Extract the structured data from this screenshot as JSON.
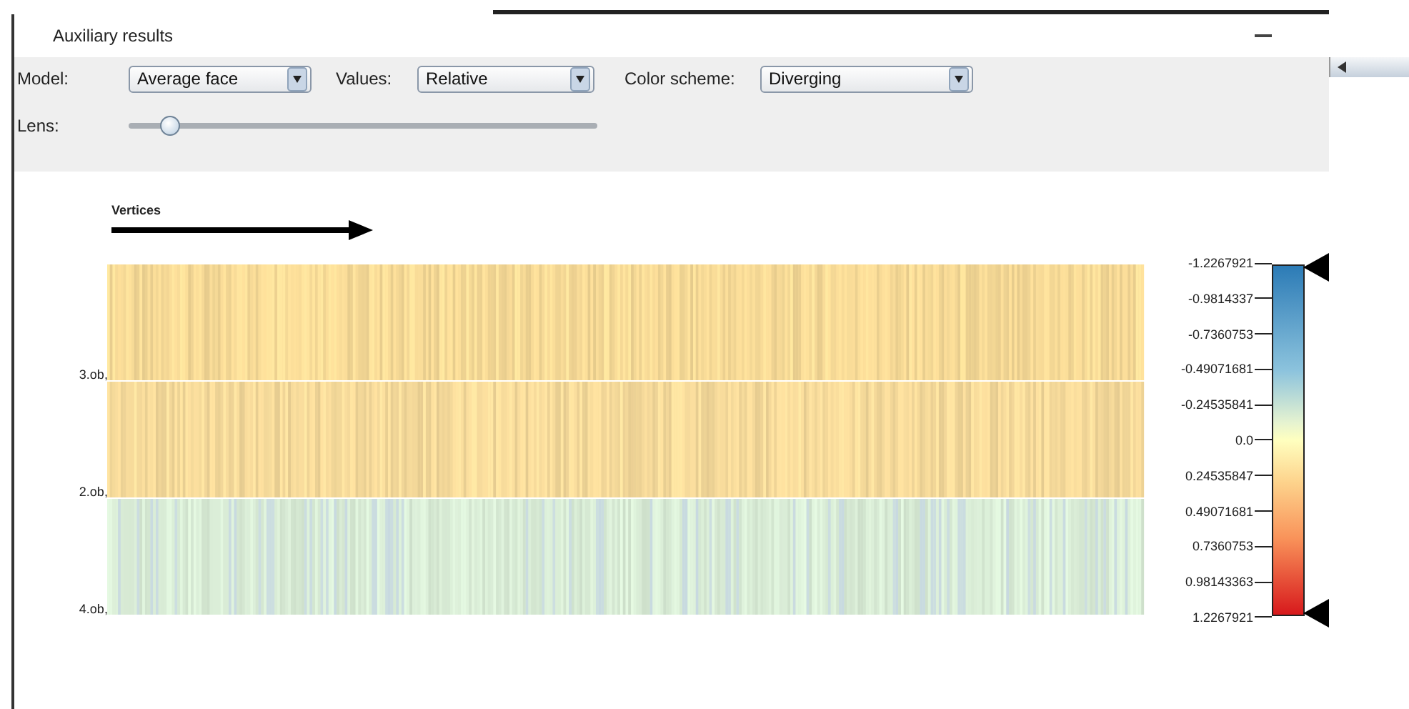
{
  "window": {
    "title": "Auxiliary results"
  },
  "controls": [
    {
      "label": "Model:",
      "value": "Average face"
    },
    {
      "label": "Values:",
      "value": "Relative"
    },
    {
      "label": "Color scheme:",
      "value": "Diverging"
    }
  ],
  "lens": {
    "label": "Lens:",
    "level": 0.07
  },
  "axis": {
    "label": "Vertices"
  },
  "rows": [
    {
      "label": "3.ob,",
      "color": "#f9dc98"
    },
    {
      "label": "2.ob,",
      "color": "#f8dc9c"
    },
    {
      "label": "4.ob,",
      "color": "#d9ecd6"
    }
  ],
  "legend": {
    "ticks": [
      "-1.2267921",
      "-0.9814337",
      "-0.7360753",
      "-0.49071681",
      "-0.24535841",
      "0.0",
      "0.24535847",
      "0.49071681",
      "0.7360753",
      "0.98143363",
      "1.2267921"
    ]
  }
}
